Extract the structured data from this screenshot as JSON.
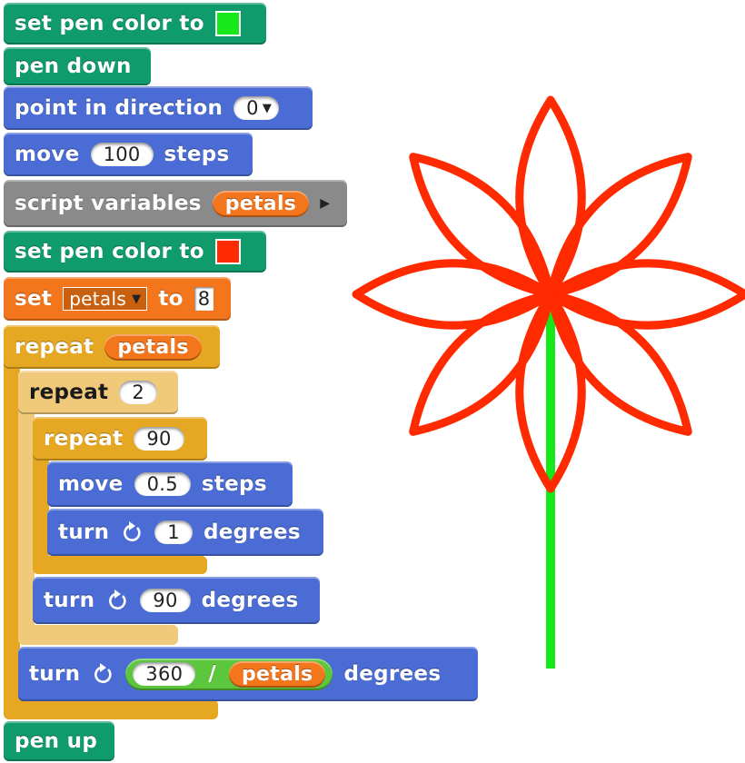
{
  "blocks": {
    "set_pen_color_1": {
      "label": "set pen color to",
      "color": "#16e81a"
    },
    "pen_down": {
      "label": "pen down"
    },
    "point_direction": {
      "label": "point in direction",
      "value": "0"
    },
    "move_steps": {
      "label": "move",
      "value": "100",
      "suffix": "steps"
    },
    "script_variables": {
      "label": "script variables",
      "var": "petals"
    },
    "set_pen_color_2": {
      "label": "set pen color to",
      "color": "#ff2a00"
    },
    "set_var": {
      "label": "set",
      "var": "petals",
      "to": "to",
      "value": "8"
    },
    "repeat_outer": {
      "label": "repeat",
      "var": "petals"
    },
    "repeat_mid": {
      "label": "repeat",
      "value": "2"
    },
    "repeat_inner": {
      "label": "repeat",
      "value": "90"
    },
    "move_small": {
      "label": "move",
      "value": "0.5",
      "suffix": "steps"
    },
    "turn_1": {
      "label": "turn",
      "value": "1",
      "suffix": "degrees"
    },
    "turn_90": {
      "label": "turn",
      "value": "90",
      "suffix": "degrees"
    },
    "turn_div": {
      "label": "turn",
      "numerator": "360",
      "op": "/",
      "var": "petals",
      "suffix": "degrees"
    },
    "pen_up": {
      "label": "pen up"
    }
  },
  "drawing": {
    "petal_color": "#ff2a00",
    "stem_color": "#16e81a",
    "petals": 8
  }
}
